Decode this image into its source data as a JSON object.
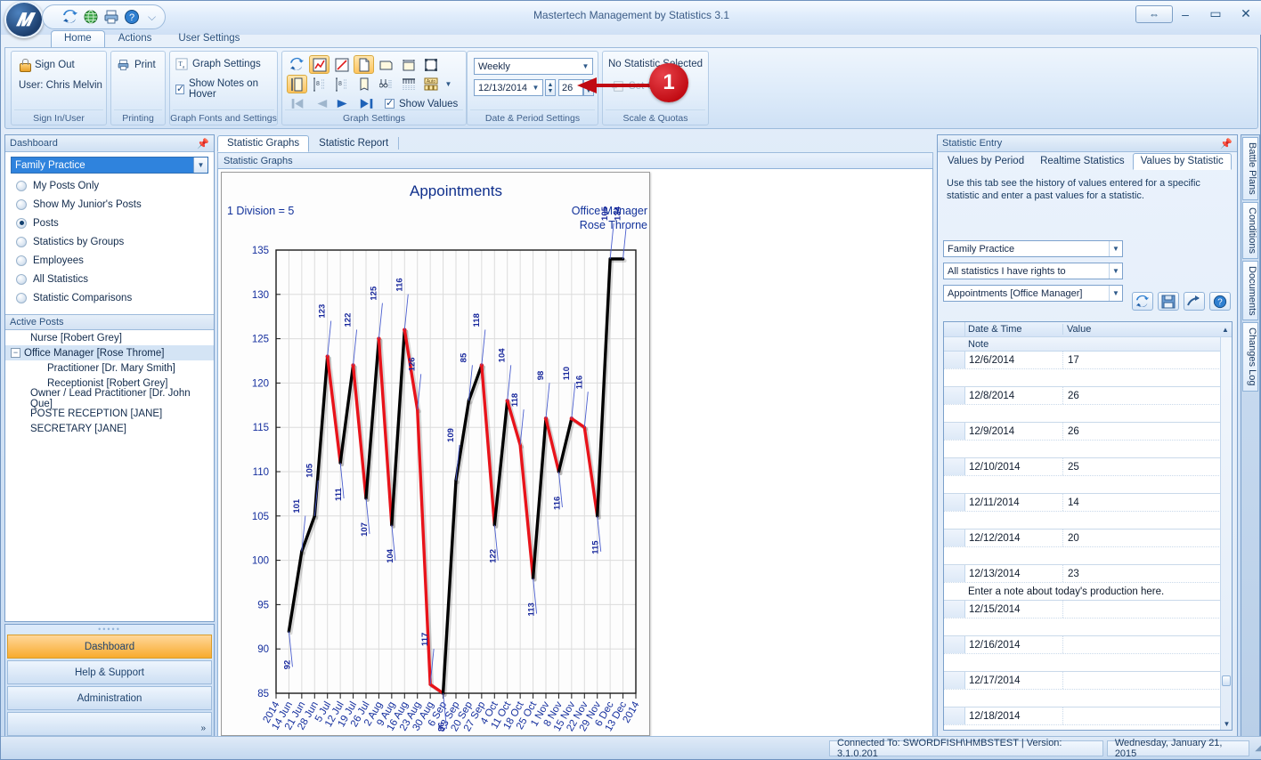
{
  "window": {
    "title": "Mastertech Management by Statistics 3.1",
    "restore_label": "⇔",
    "minimize_label": "–",
    "maximize_label": "▭",
    "close_label": "✕",
    "qat": [
      "refresh-icon",
      "globe-icon",
      "print-icon",
      "help-icon"
    ],
    "qat_overflow": "⌵"
  },
  "ribbon": {
    "tabs": [
      {
        "label": "Home",
        "active": true
      },
      {
        "label": "Actions",
        "active": false
      },
      {
        "label": "User Settings",
        "active": false
      }
    ],
    "groups": [
      {
        "name": "Sign In/User",
        "title": "Sign In/User",
        "sign_out": "Sign Out",
        "user_line": "User: Chris Melvin"
      },
      {
        "name": "Printing",
        "title": "Printing",
        "print": "Print"
      },
      {
        "name": "Graph Fonts and Settings",
        "title": "Graph Fonts and Settings",
        "graph_settings": "Graph Settings",
        "show_notes": "Show Notes on Hover",
        "show_notes_checked": true
      },
      {
        "name": "Graph Settings",
        "title": "Graph Settings",
        "show_values": "Show Values",
        "show_values_checked": true
      },
      {
        "name": "Date & Period Settings",
        "title": "Date & Period Settings",
        "period": "Weekly",
        "date": "12/13/2014",
        "count": "26"
      },
      {
        "name": "Scale & Quotas",
        "title": "Scale & Quotas",
        "no_statistic": "No Statistic Selected",
        "set_graph": "Set Graph"
      }
    ]
  },
  "annotation": {
    "step_number": "1"
  },
  "dashboard": {
    "header": "Dashboard",
    "pin": "📌",
    "practice_select": "Family Practice",
    "options": [
      {
        "label": "My Posts Only",
        "selected": false
      },
      {
        "label": "Show My Junior's Posts",
        "selected": false
      },
      {
        "label": "Posts",
        "selected": true
      },
      {
        "label": "Statistics by Groups",
        "selected": false
      },
      {
        "label": "Employees",
        "selected": false
      },
      {
        "label": "All Statistics",
        "selected": false
      },
      {
        "label": "Statistic Comparisons",
        "selected": false
      }
    ],
    "active_posts_header": "Active Posts",
    "posts": [
      {
        "label": "Nurse [Robert Grey]",
        "indent": 1,
        "expander": false,
        "selected": false
      },
      {
        "label": "Office Manager [Rose Throme]",
        "indent": 0,
        "expander": true,
        "selected": true
      },
      {
        "label": "Practitioner  [Dr. Mary Smith]",
        "indent": 2,
        "expander": false,
        "selected": false
      },
      {
        "label": "Receptionist  [Robert Grey]",
        "indent": 2,
        "expander": false,
        "selected": false
      },
      {
        "label": "Owner / Lead Practitioner  [Dr. John Que]",
        "indent": 1,
        "expander": false,
        "selected": false
      },
      {
        "label": "POSTE RECEPTION [JANE]",
        "indent": 1,
        "expander": false,
        "selected": false
      },
      {
        "label": "SECRETARY [JANE]",
        "indent": 1,
        "expander": false,
        "selected": false
      }
    ],
    "nav_buttons": [
      {
        "label": "Dashboard",
        "active": true
      },
      {
        "label": "Help & Support",
        "active": false
      },
      {
        "label": "Administration",
        "active": false
      }
    ],
    "nav_more": "»"
  },
  "center": {
    "tabs": [
      {
        "label": "Statistic Graphs",
        "active": true
      },
      {
        "label": "Statistic Report",
        "active": false
      }
    ],
    "subtitle": "Statistic Graphs"
  },
  "chart_data": {
    "type": "line",
    "title": "Appointments",
    "subtitle_line1": "Office Manager",
    "subtitle_line2": "Rose Throrne",
    "division_note": "1 Division = 5",
    "xlabel": "",
    "ylabel": "",
    "ylim": [
      85,
      135
    ],
    "yticks": [
      85,
      90,
      95,
      100,
      105,
      110,
      115,
      120,
      125,
      130,
      135
    ],
    "grid": true,
    "legend_position": "none",
    "axis_start_label": "2014",
    "axis_end_label": "2014",
    "categories": [
      "14 Jun",
      "21 Jun",
      "28 Jun",
      "5 Jul",
      "12 Jul",
      "19 Jul",
      "26 Jul",
      "2 Aug",
      "9 Aug",
      "16 Aug",
      "23 Aug",
      "30 Aug",
      "6 Sep",
      "13 Sep",
      "20 Sep",
      "27 Sep",
      "4 Oct",
      "11 Oct",
      "18 Oct",
      "25 Oct",
      "1 Nov",
      "8 Nov",
      "15 Nov",
      "22 Nov",
      "29 Nov",
      "6 Dec",
      "13 Dec"
    ],
    "series": [
      {
        "name": "Black Line",
        "color": "#000000",
        "values": [
          92,
          101,
          105,
          123,
          111,
          122,
          107,
          125,
          104,
          126,
          117,
          86,
          85,
          109,
          118,
          122,
          104,
          118,
          113,
          98,
          116,
          110,
          116,
          115,
          105,
          134,
          134
        ]
      },
      {
        "name": "Red Line",
        "color": "#e8131a",
        "values": [
          92,
          101,
          105,
          123,
          111,
          122,
          107,
          125,
          104,
          126,
          117,
          86,
          85,
          109,
          118,
          122,
          104,
          118,
          113,
          98,
          116,
          110,
          116,
          115,
          105,
          134,
          134
        ]
      }
    ],
    "point_labels": [
      {
        "label": "92",
        "x": 0
      },
      {
        "label": "101",
        "x": 1
      },
      {
        "label": "105",
        "x": 2
      },
      {
        "label": "123",
        "x": 3
      },
      {
        "label": "111",
        "x": 4
      },
      {
        "label": "122",
        "x": 5
      },
      {
        "label": "107",
        "x": 6
      },
      {
        "label": "125",
        "x": 7
      },
      {
        "label": "104",
        "x": 8
      },
      {
        "label": "116",
        "x": 9
      },
      {
        "label": "126",
        "x": 10
      },
      {
        "label": "117",
        "x": 11
      },
      {
        "label": "86",
        "x": 12
      },
      {
        "label": "109",
        "x": 13
      },
      {
        "label": "85",
        "x": 14
      },
      {
        "label": "118",
        "x": 15
      },
      {
        "label": "122",
        "x": 16
      },
      {
        "label": "104",
        "x": 17
      },
      {
        "label": "118",
        "x": 18
      },
      {
        "label": "113",
        "x": 19
      },
      {
        "label": "98",
        "x": 20
      },
      {
        "label": "116",
        "x": 21
      },
      {
        "label": "110",
        "x": 22
      },
      {
        "label": "116",
        "x": 23
      },
      {
        "label": "115",
        "x": 24
      },
      {
        "label": "105",
        "x": 25
      },
      {
        "label": "134",
        "x": 26
      }
    ]
  },
  "statistic_entry": {
    "header": "Statistic Entry",
    "pin": "📌",
    "tabs": [
      {
        "label": "Values by Period",
        "active": false
      },
      {
        "label": "Realtime Statistics",
        "active": false
      },
      {
        "label": "Values by Statistic",
        "active": true
      }
    ],
    "help_text": "Use this tab see the history of values entered for a specific statistic and enter a past values for a statistic.",
    "select_practice": "Family Practice",
    "select_rights": "All statistics I have rights to",
    "select_statistic": "Appointments [Office Manager]",
    "toolbar_icons": [
      "refresh-icon",
      "save-icon",
      "export-icon",
      "help-icon"
    ],
    "grid_headers": [
      "Date & Time",
      "Value"
    ],
    "note_header": "Note",
    "rows": [
      {
        "date": "12/6/2014",
        "value": "17",
        "note": ""
      },
      {
        "date": "12/8/2014",
        "value": "26",
        "note": ""
      },
      {
        "date": "12/9/2014",
        "value": "26",
        "note": ""
      },
      {
        "date": "12/10/2014",
        "value": "25",
        "note": ""
      },
      {
        "date": "12/11/2014",
        "value": "14",
        "note": ""
      },
      {
        "date": "12/12/2014",
        "value": "20",
        "note": ""
      },
      {
        "date": "12/13/2014",
        "value": "23",
        "note": "Enter a note about today's production here."
      },
      {
        "date": "12/15/2014",
        "value": "",
        "note": ""
      },
      {
        "date": "12/16/2014",
        "value": "",
        "note": ""
      },
      {
        "date": "12/17/2014",
        "value": "",
        "note": ""
      },
      {
        "date": "12/18/2014",
        "value": "",
        "note": ""
      }
    ],
    "scroll_up": "▲",
    "scroll_down": "▼"
  },
  "side_tabs": [
    {
      "label": "Battle Plans"
    },
    {
      "label": "Conditions"
    },
    {
      "label": "Documents"
    },
    {
      "label": "Changes Log"
    }
  ],
  "status": {
    "connection": "Connected To: SWORDFISH\\HMBSTEST | Version: 3.1.0.201",
    "date": "Wednesday, January 21, 2015"
  },
  "colors": {
    "accent": "#f8ab2e",
    "series_black": "#000000",
    "series_red": "#e8131a",
    "chart_text": "#15259b",
    "annotation": "#c00a12"
  }
}
